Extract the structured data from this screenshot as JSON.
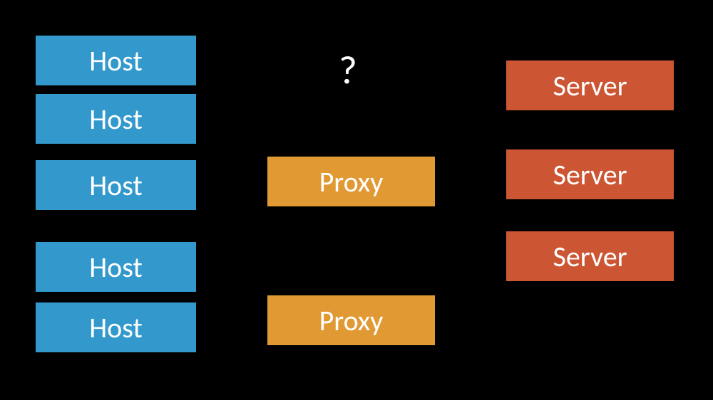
{
  "question_mark": "?",
  "hosts": [
    "Host",
    "Host",
    "Host",
    "Host",
    "Host"
  ],
  "proxies": [
    "Proxy",
    "Proxy"
  ],
  "servers": [
    "Server",
    "Server",
    "Server"
  ],
  "colors": {
    "host": "#3399cc",
    "proxy": "#e09933",
    "server": "#cc5533",
    "background": "#000000",
    "text": "#ffffff"
  }
}
